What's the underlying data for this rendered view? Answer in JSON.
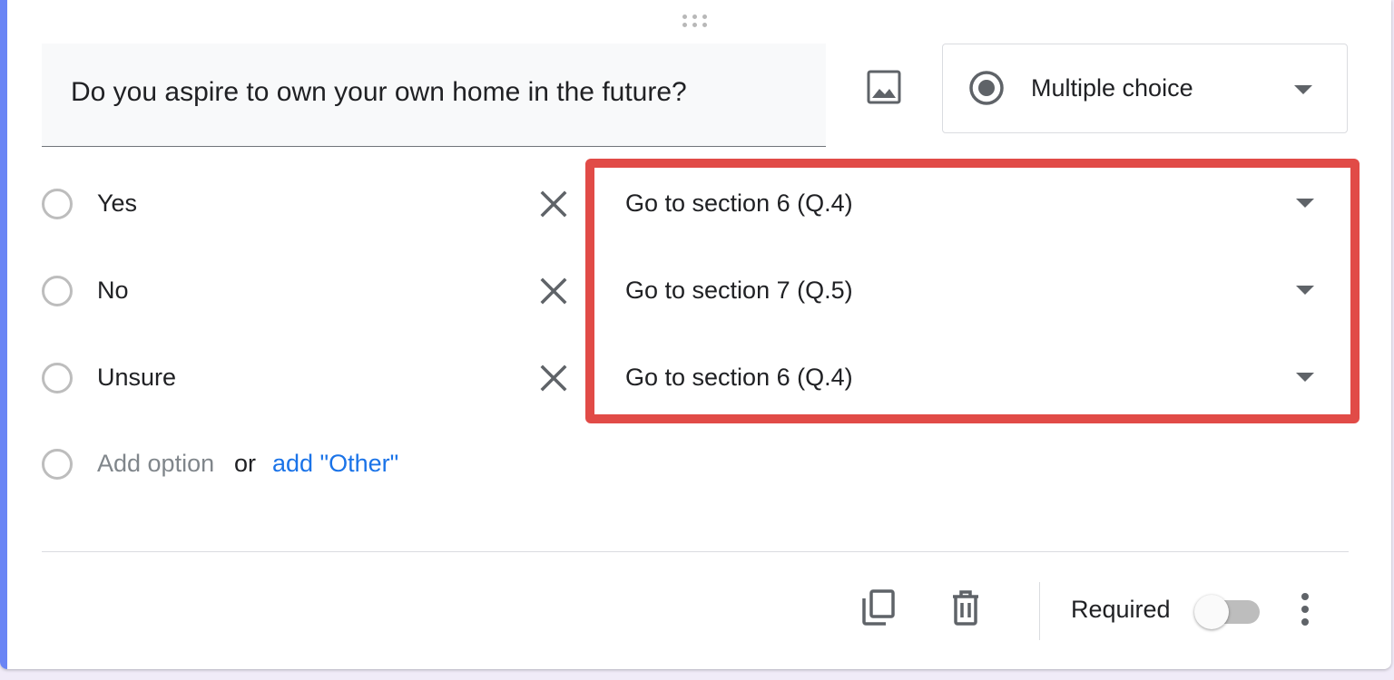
{
  "question": {
    "title": "Do you aspire to own your own home in the future?"
  },
  "question_type": {
    "selected": "Multiple choice",
    "icon": "radio-button-icon"
  },
  "options": [
    {
      "label": "Yes",
      "go_to": "Go to section 6 (Q.4)"
    },
    {
      "label": "No",
      "go_to": "Go to section 7 (Q.5)"
    },
    {
      "label": "Unsure",
      "go_to": "Go to section 6 (Q.4)"
    }
  ],
  "add_option": {
    "label": "Add option",
    "or": "or",
    "other_link": "add \"Other\""
  },
  "footer": {
    "required_label": "Required",
    "required_on": false
  },
  "colors": {
    "accent": "#6a85f5",
    "highlight": "#e14b47",
    "link": "#1a73e8"
  }
}
